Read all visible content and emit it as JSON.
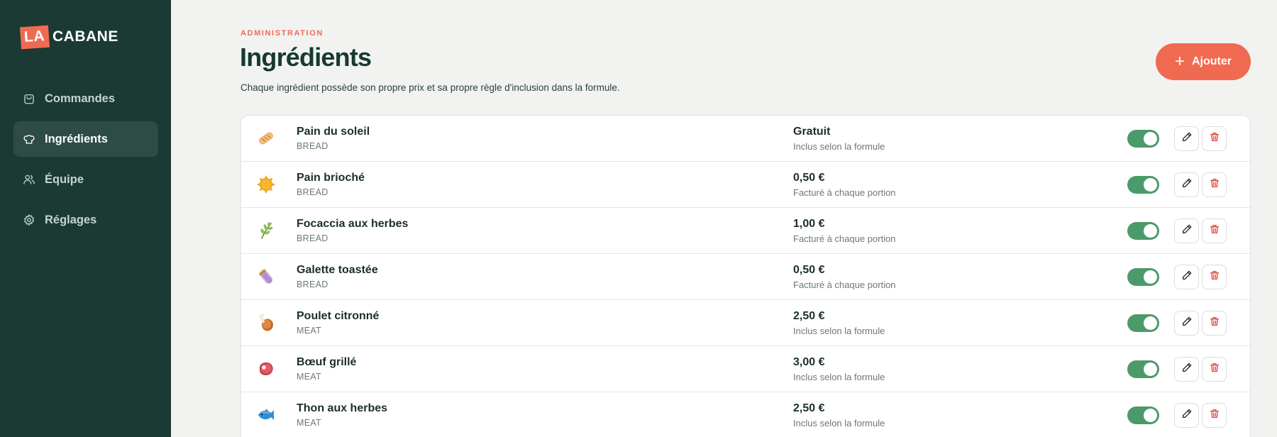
{
  "brand": {
    "badge": "LA",
    "name": "CABANE"
  },
  "sidebar": {
    "items": [
      {
        "label": "Commandes",
        "icon": "shopping-bag-icon",
        "active": false
      },
      {
        "label": "Ingrédients",
        "icon": "chef-hat-icon",
        "active": true
      },
      {
        "label": "Équipe",
        "icon": "users-icon",
        "active": false
      },
      {
        "label": "Réglages",
        "icon": "gear-icon",
        "active": false
      }
    ]
  },
  "header": {
    "eyebrow": "ADMINISTRATION",
    "title": "Ingrédients",
    "subtitle": "Chaque ingrédient possède son propre prix et sa propre règle d'inclusion dans la formule.",
    "add_label": "Ajouter"
  },
  "ingredients": [
    {
      "name": "Pain du soleil",
      "category": "BREAD",
      "price": "Gratuit",
      "rule": "Inclus selon la formule",
      "icon": "bread-icon",
      "enabled": true
    },
    {
      "name": "Pain brioché",
      "category": "BREAD",
      "price": "0,50 €",
      "rule": "Facturé à chaque portion",
      "icon": "sun-icon",
      "enabled": true
    },
    {
      "name": "Focaccia aux herbes",
      "category": "BREAD",
      "price": "1,00 €",
      "rule": "Facturé à chaque portion",
      "icon": "herb-icon",
      "enabled": true
    },
    {
      "name": "Galette toastée",
      "category": "BREAD",
      "price": "0,50 €",
      "rule": "Facturé à chaque portion",
      "icon": "wrap-icon",
      "enabled": true
    },
    {
      "name": "Poulet citronné",
      "category": "MEAT",
      "price": "2,50 €",
      "rule": "Inclus selon la formule",
      "icon": "chicken-leg-icon",
      "enabled": true
    },
    {
      "name": "Bœuf grillé",
      "category": "MEAT",
      "price": "3,00 €",
      "rule": "Inclus selon la formule",
      "icon": "steak-icon",
      "enabled": true
    },
    {
      "name": "Thon aux herbes",
      "category": "MEAT",
      "price": "2,50 €",
      "rule": "Inclus selon la formule",
      "icon": "fish-icon",
      "enabled": true
    }
  ],
  "colors": {
    "sidebar": "#1a3a33",
    "accent": "#f06a52",
    "toggle_on": "#4a9b69",
    "delete": "#d9463b"
  }
}
